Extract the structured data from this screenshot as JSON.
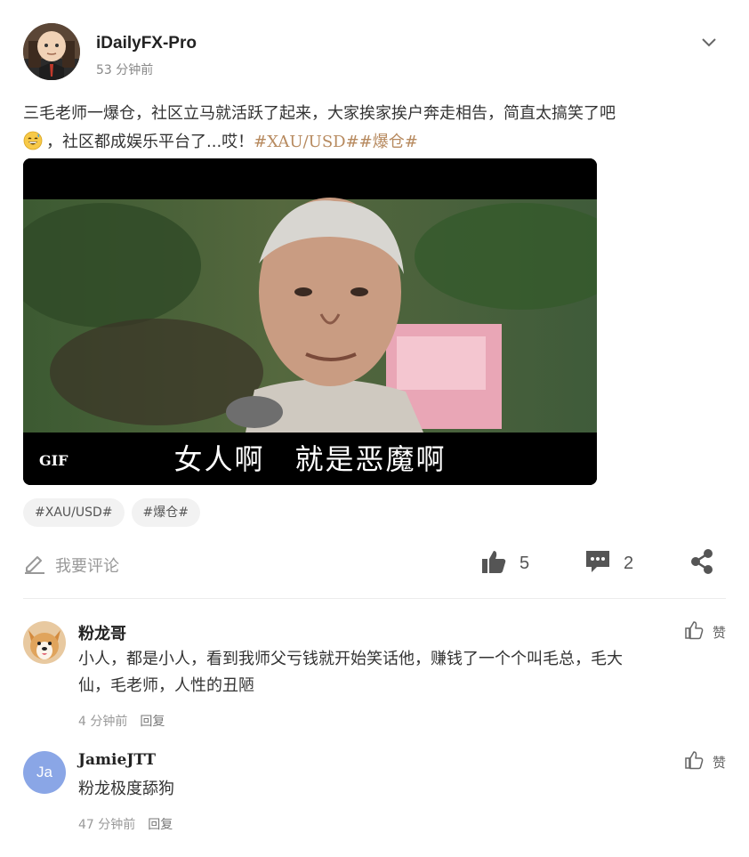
{
  "post": {
    "author": "iDailyFX-Pro",
    "time": "53 分钟前",
    "text_line1": "三毛老师一爆仓，社区立马就活跃了起来，大家挨家挨户奔走相告，简直太搞笑了吧",
    "text_line2": "，社区都成娱乐平台了...哎！",
    "inline_tags": "#XAU/USD##爆仓#",
    "emoji_icon": "grinning-sweat-emoji"
  },
  "media": {
    "badge": "GIF",
    "subtitle": "女人啊　就是恶魔啊"
  },
  "tags": [
    "#XAU/USD#",
    "#爆仓#"
  ],
  "actions": {
    "comment_placeholder": "我要评论",
    "like_count": "5",
    "comment_count": "2"
  },
  "comments": [
    {
      "name": "粉龙哥",
      "text_line1": "小人，都是小人，看到我师父亏钱就开始笑话他，赚钱了一个个叫毛总，毛大",
      "text_line2": "仙，毛老师，人性的丑陋",
      "time": "4 分钟前",
      "reply": "回复",
      "like_label": "赞"
    },
    {
      "name": "JamieJTT",
      "avatar_initials": "Ja",
      "text_line1": "粉龙极度舔狗",
      "time": "47 分钟前",
      "reply": "回复",
      "like_label": "赞"
    }
  ],
  "colors": {
    "hashtag": "#b78a5f",
    "avatar_ja": "#8aa6e6",
    "muted": "#999999"
  }
}
